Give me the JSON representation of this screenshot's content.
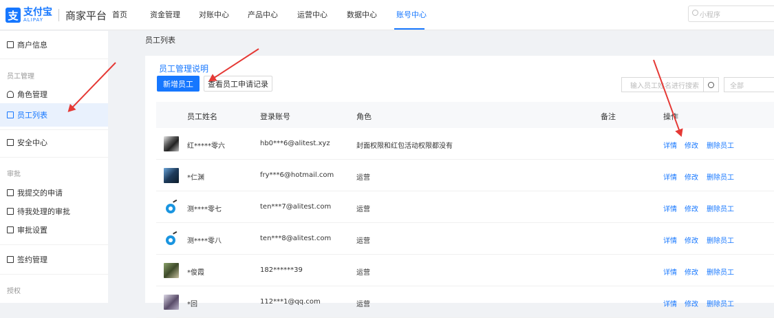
{
  "header": {
    "logo_mark": "支",
    "logo_cn": "支付宝",
    "logo_en": "ALIPAY",
    "platform": "商家平台",
    "nav": [
      "首页",
      "资金管理",
      "对账中心",
      "产品中心",
      "运营中心",
      "数据中心",
      "账号中心"
    ],
    "active_nav": "账号中心",
    "search_placeholder": "小程序"
  },
  "sidebar": {
    "merchant_info": "商户信息",
    "group_staff": "员工管理",
    "role_manage": "角色管理",
    "staff_list": "员工列表",
    "security": "安全中心",
    "group_approval": "审批",
    "my_submitted": "我提交的申请",
    "pending_approval": "待我处理的审批",
    "approval_settings": "审批设置",
    "contract": "签约管理",
    "group_auth": "授权"
  },
  "main": {
    "breadcrumb": "员工列表",
    "guide_link": "员工管理说明",
    "add_button": "新增员工",
    "records_button": "查看员工申请记录",
    "search_placeholder": "输入员工姓名进行搜索",
    "filter_value": "全部",
    "columns": [
      "员工姓名",
      "登录账号",
      "角色",
      "备注",
      "操作"
    ],
    "rows": [
      {
        "name": "红*****零六",
        "account": "hb0***6@alitest.xyz",
        "role": "封面权限和红包活动权限都没有"
      },
      {
        "name": "*仁渊",
        "account": "fry***6@hotmail.com",
        "role": "运营"
      },
      {
        "name": "测****零七",
        "account": "ten***7@alitest.com",
        "role": "运营"
      },
      {
        "name": "测****零八",
        "account": "ten***8@alitest.com",
        "role": "运营"
      },
      {
        "name": "*俊霞",
        "account": "182******39",
        "role": "运营"
      },
      {
        "name": "*回",
        "account": "112***1@qq.com",
        "role": "运营"
      }
    ],
    "actions": {
      "detail": "详情",
      "edit": "修改",
      "delete": "删除员工"
    }
  }
}
